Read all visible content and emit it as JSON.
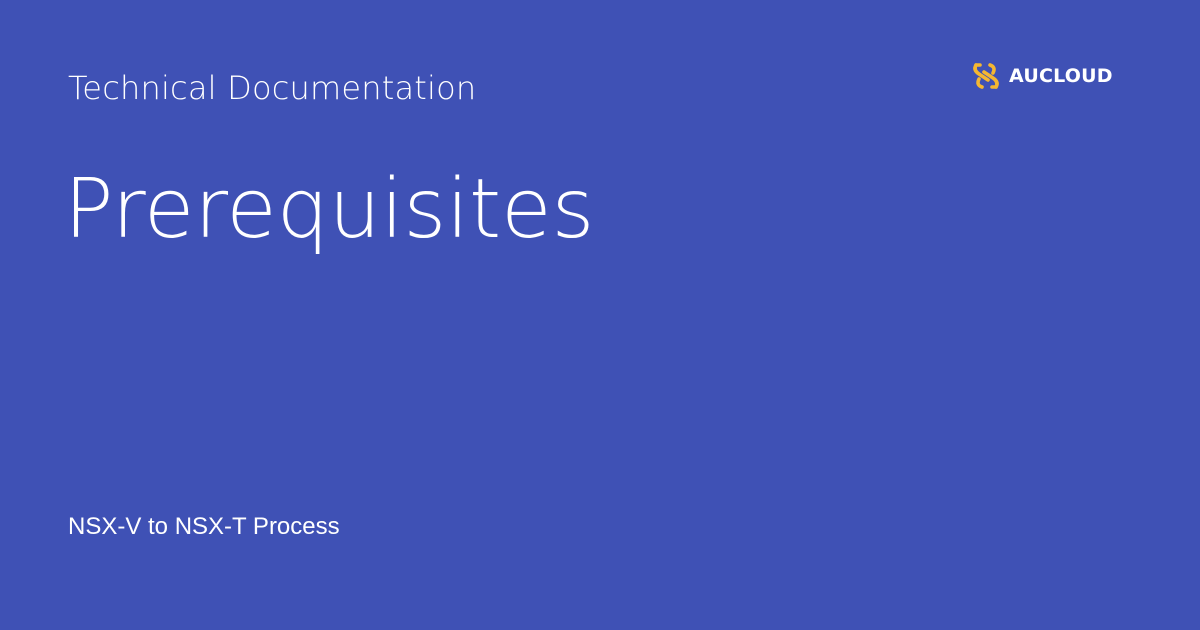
{
  "header": {
    "section_label": "Technical Documentation",
    "brand_name": "AUCLOUD",
    "brand_icon": "aucloud-logo-icon"
  },
  "main": {
    "title": "Prerequisites",
    "subtitle": "NSX-V to NSX-T Process"
  },
  "colors": {
    "background": "#3f51b5",
    "text": "#ffffff",
    "logo_accent": "#f5b731"
  }
}
